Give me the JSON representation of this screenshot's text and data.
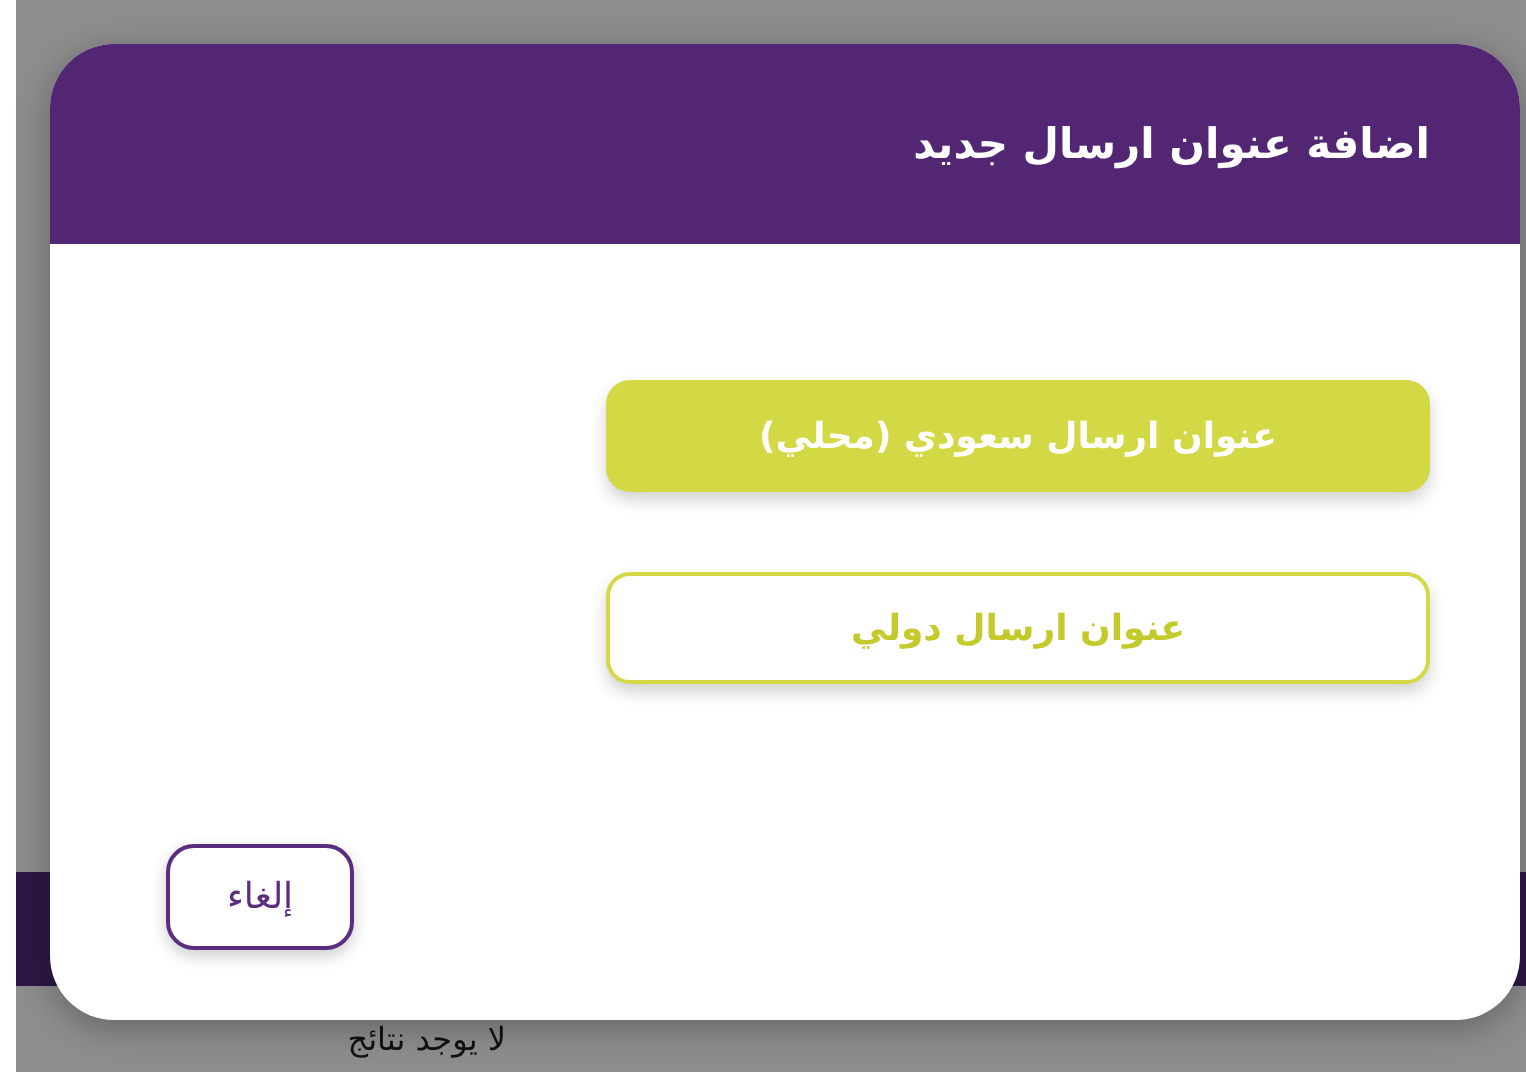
{
  "background_page": {
    "empty_message": "لا يوجد نتائج"
  },
  "dialog": {
    "title": "اضافة عنوان ارسال جديد",
    "options": [
      {
        "label": "عنوان ارسال سعودي (محلي)",
        "kind": "filled"
      },
      {
        "label": "عنوان ارسال دولي",
        "kind": "outline"
      }
    ],
    "cancel_button": "إلغاء"
  }
}
